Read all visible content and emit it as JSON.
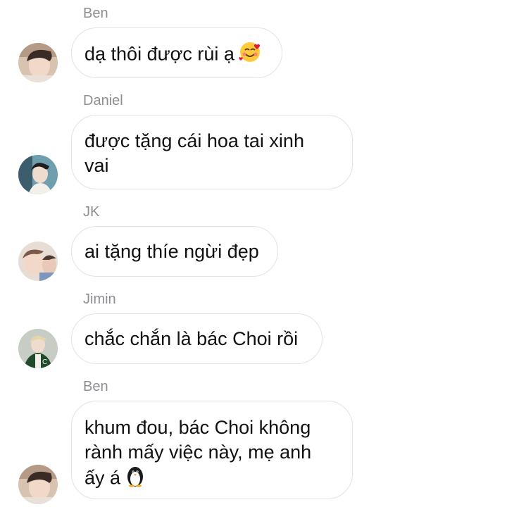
{
  "messages": [
    {
      "sender": "Ben",
      "text": "dạ thôi được rùi ạ",
      "emoji": "smiling-face-with-hearts-icon",
      "avatar": "avatar-ben"
    },
    {
      "sender": "Daniel",
      "lines": [
        "được tặng cái hoa tai xinh",
        "vai"
      ],
      "avatar": "avatar-daniel"
    },
    {
      "sender": "JK",
      "text": "ai tặng thíe ngừi đẹp",
      "avatar": "avatar-jk"
    },
    {
      "sender": "Jimin",
      "text": "chắc chắn là bác Choi rồi",
      "avatar": "avatar-jimin"
    },
    {
      "sender": "Ben",
      "lines": [
        "khum đou, bác Choi không",
        "rành mấy việc này, mẹ anh",
        "ấy á"
      ],
      "emoji": "penguin-icon",
      "avatar": "avatar-ben"
    }
  ],
  "colors": {
    "bubble_border": "#e3e3e7",
    "name_text": "#8e8e93",
    "message_text": "#111111"
  }
}
